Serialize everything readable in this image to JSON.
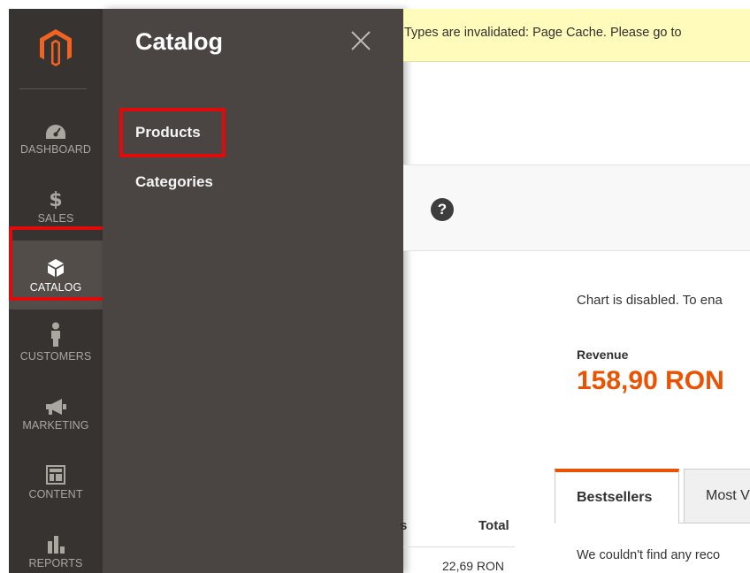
{
  "nav": {
    "items": [
      {
        "label": "DASHBOARD",
        "icon": "dashboard-gauge-icon"
      },
      {
        "label": "SALES",
        "icon": "dollar-icon"
      },
      {
        "label": "CATALOG",
        "icon": "cube-icon",
        "active": true
      },
      {
        "label": "CUSTOMERS",
        "icon": "person-icon"
      },
      {
        "label": "MARKETING",
        "icon": "megaphone-icon"
      },
      {
        "label": "CONTENT",
        "icon": "layout-icon"
      },
      {
        "label": "REPORTS",
        "icon": "bar-chart-icon"
      }
    ],
    "brand_color": "#f26322"
  },
  "submenu": {
    "title": "Catalog",
    "items": [
      "Products",
      "Categories"
    ]
  },
  "notice": {
    "text": "Types are invalidated: Page Cache. Please go to"
  },
  "main": {
    "help_label": "?",
    "chart_note": "Chart is disabled. To ena",
    "revenue_label": "Revenue",
    "revenue_value": "158,90 RON",
    "tabs": [
      "Bestsellers",
      "Most V"
    ],
    "empty_text": "We couldn't find any reco",
    "table": {
      "header_partial": "s",
      "header_total": "Total",
      "first_total": "22,69 RON"
    }
  },
  "colors": {
    "accent": "#eb5202",
    "highlight": "#e00a0a",
    "nav_bg": "#373330",
    "submenu_bg": "#4a4542"
  }
}
